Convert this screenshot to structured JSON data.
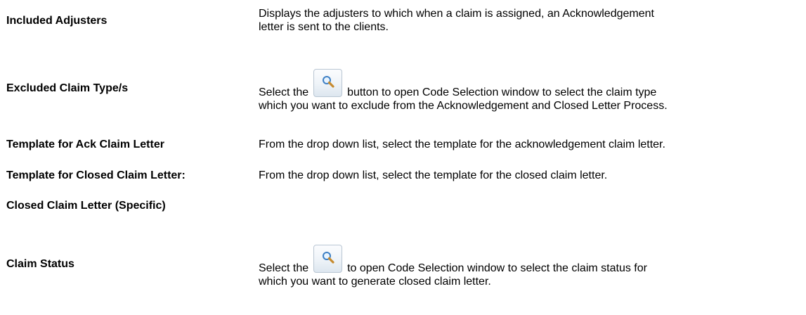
{
  "rows": [
    {
      "term": "Included Adjusters",
      "desc_line1": "Displays the adjusters to which when a claim is assigned, an Acknowledgement",
      "desc_line2": "letter is sent to the clients."
    },
    {
      "term": "Excluded Claim Type/s",
      "desc_before": "Select the",
      "desc_after": "button to open Code Selection window to select the claim  type",
      "desc_line2": "which you want to exclude from the Acknowledgement and Closed Letter Process."
    },
    {
      "term": "Template for Ack Claim Letter",
      "desc_line1": "From the drop down list, select the template for the acknowledgement claim letter."
    },
    {
      "term": "Template for Closed Claim Letter:",
      "desc_line1": "From the drop down list, select the template for the closed claim letter."
    },
    {
      "term": "Closed Claim Letter (Specific)"
    },
    {
      "term": "Claim Status",
      "desc_before": "Select the",
      "desc_after": "to open Code Selection window to select the claim status for",
      "desc_line2": "which you want to generate closed claim letter."
    }
  ],
  "icons": {
    "lookup": "magnifier-icon"
  }
}
